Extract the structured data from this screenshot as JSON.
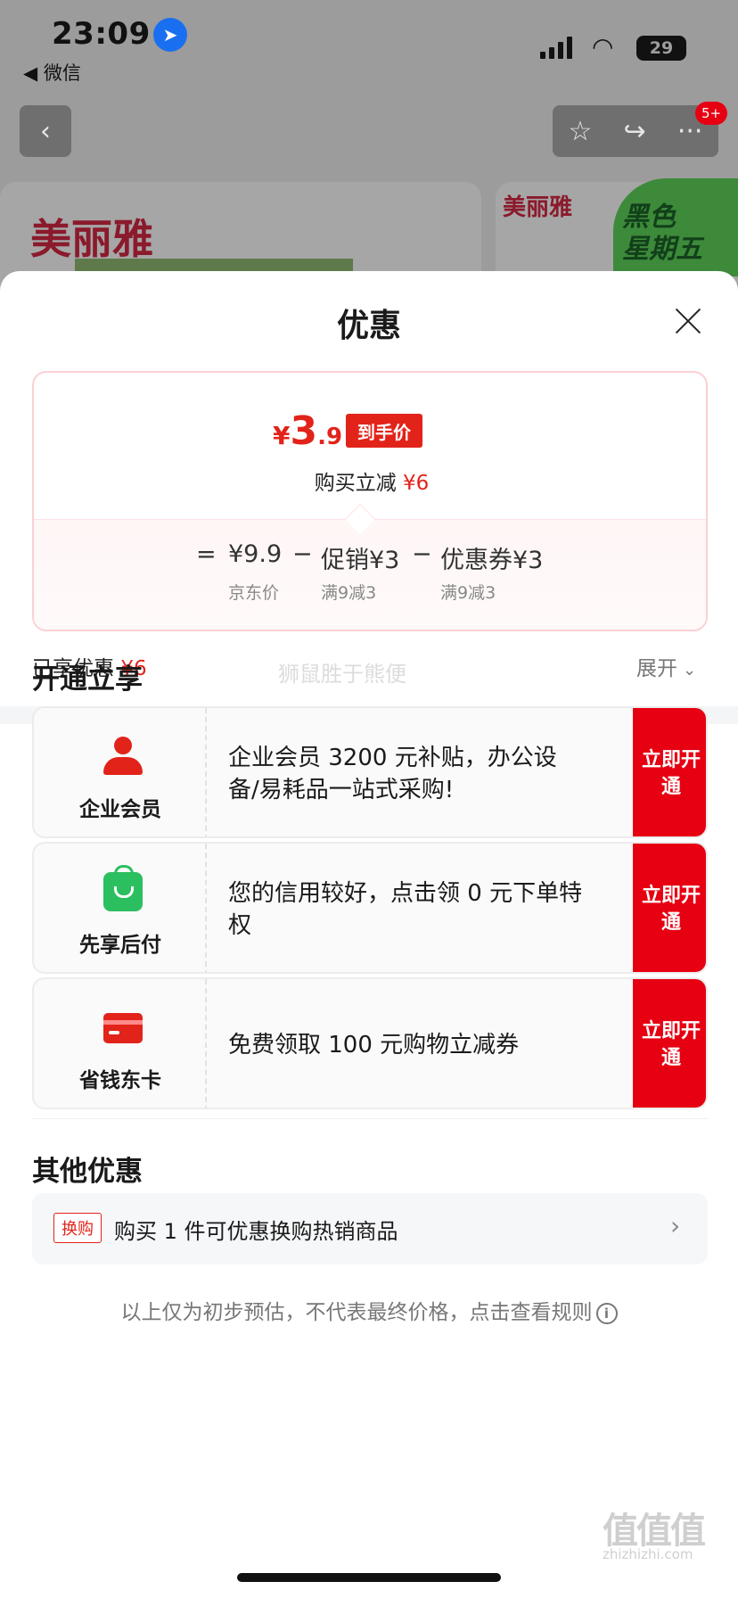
{
  "status_bar": {
    "time": "23:09",
    "back_app": "◀ 微信",
    "battery": "29"
  },
  "nav": {
    "back_icon": "‹",
    "star_icon": "☆",
    "share_icon": "↪",
    "more_icon": "···",
    "badge": "5+"
  },
  "background": {
    "brand_logo": "美丽雅",
    "brand_logo_small": "美丽雅",
    "promo_banner": "黑色星期五",
    "promo_line1": "黑色",
    "promo_line2": "星期五"
  },
  "sheet": {
    "title": "优惠",
    "price_summary": {
      "currency": "¥",
      "final_int": "3",
      "final_dec": ".9",
      "final_tag": "到手价",
      "reduce_label": "购买立减",
      "reduce_amount": "¥6",
      "calc": {
        "equals": "=",
        "base_price": "¥9.9",
        "base_label": "京东价",
        "minus1": "−",
        "promo": "促销¥3",
        "promo_rule": "满9减3",
        "minus2": "−",
        "coupon": "优惠券¥3",
        "coupon_rule": "满9减3"
      }
    },
    "enjoyed_label": "已享优惠",
    "enjoyed_amount": "¥6",
    "expand_label": "展开",
    "expand_icon": "⌄",
    "open_section_title": "开通立享",
    "watermark": "狮鼠胜于熊便",
    "memberships": [
      {
        "icon": "person-icon",
        "name": "企业会员",
        "desc": "企业会员 3200 元补贴，办公设备/易耗品一站式采购!",
        "button": "立即开通"
      },
      {
        "icon": "shopping-bag-icon",
        "name": "先享后付",
        "desc": "您的信用较好，点击领 0 元下单特权",
        "button": "立即开通"
      },
      {
        "icon": "card-icon",
        "name": "省钱东卡",
        "desc": "免费领取 100 元购物立减券",
        "button": "立即开通"
      }
    ],
    "other_section_title": "其他优惠",
    "other_offer": {
      "tag": "换购",
      "text": "购买 1 件可优惠换购热销商品",
      "chevron": "›"
    },
    "disclaimer": "以上仅为初步预估，不代表最终价格，点击查看规则",
    "info_icon": "i"
  },
  "site_watermark": {
    "mark": "值值值",
    "url": "zhizhizhi.com"
  }
}
